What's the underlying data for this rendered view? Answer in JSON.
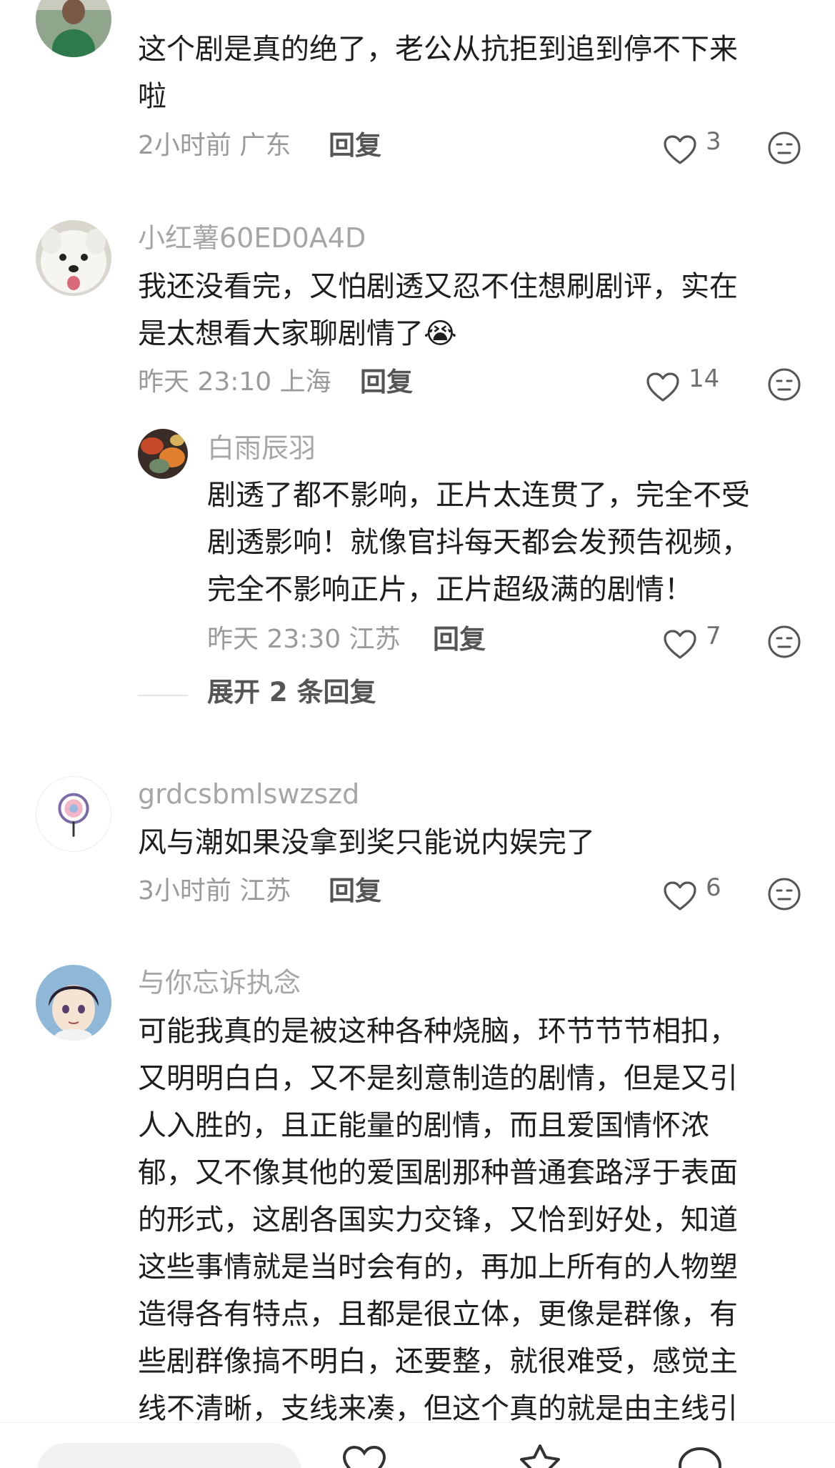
{
  "comments": [
    {
      "username": "",
      "lines": [
        "这个剧是真的绝了，老公从抗拒到追到停不下来",
        "啦"
      ],
      "meta": "2小时前 广东",
      "reply_label": "回复",
      "likes": "3"
    },
    {
      "username": "小红薯60ED0A4D",
      "lines": [
        "我还没看完，又怕剧透又忍不住想刷剧评，实在",
        "是太想看大家聊剧情了"
      ],
      "emoji": "😭",
      "meta": "昨天 23:10 上海",
      "reply_label": "回复",
      "likes": "14",
      "sub_reply": {
        "username": "白雨辰羽",
        "lines": [
          "剧透了都不影响，正片太连贯了，完全不受",
          "剧透影响！就像官抖每天都会发预告视频，",
          "完全不影响正片，正片超级满的剧情！"
        ],
        "meta": "昨天 23:30 江苏",
        "reply_label": "回复",
        "likes": "7"
      },
      "expand_label": "展开 2 条回复"
    },
    {
      "username": "grdcsbmlswzszd",
      "lines": [
        "风与潮如果没拿到奖只能说内娱完了"
      ],
      "meta": "3小时前 江苏",
      "reply_label": "回复",
      "likes": "6"
    },
    {
      "username": "与你忘诉执念",
      "lines": [
        "可能我真的是被这种各种烧脑，环节节节相扣，",
        "又明明白白，又不是刻意制造的剧情，但是又引",
        "人入胜的，且正能量的剧情，而且爱国情怀浓",
        "郁，又不像其他的爱国剧那种普通套路浮于表面",
        "的形式，这剧各国实力交锋，又恰到好处，知道",
        "这些事情就是当时会有的，再加上所有的人物塑",
        "造得各有特点，且都是很立体，更像是群像，有",
        "些剧群像搞不明白，还要整，就很难受，感觉主",
        "线不清晰，支线来凑，但这个真的就是由主线引"
      ]
    }
  ],
  "icons": {
    "like": "heart-outline-icon",
    "dislike": "neutral-face-icon",
    "bottom_bar": [
      "heart-icon",
      "star-icon",
      "comment-icon"
    ]
  },
  "colors": {
    "username": "#a6a6a6",
    "content": "#1e1e1e",
    "meta": "#9a9a9a",
    "reply": "#555555"
  }
}
